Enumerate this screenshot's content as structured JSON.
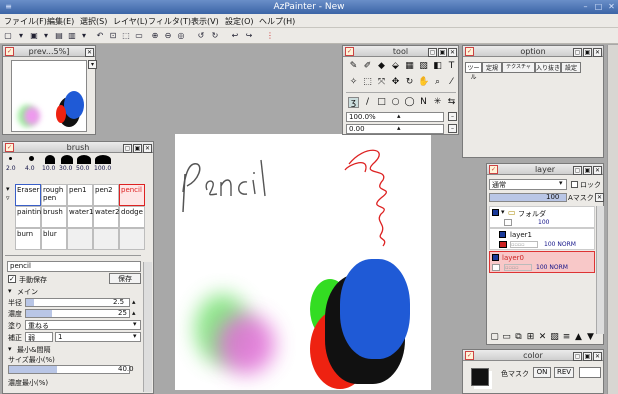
{
  "window": {
    "title": "AzPainter - New"
  },
  "menu": [
    "ファイル(F)",
    "編集(E)",
    "選択(S)",
    "レイヤ(L)",
    "フィルタ(T)",
    "表示(V)",
    "設定(O)",
    "ヘルプ(H)"
  ],
  "preview": {
    "title": "prev...5%]"
  },
  "tool": {
    "title": "tool",
    "zoom": "100.0%",
    "angle": "0.00"
  },
  "option": {
    "title": "option",
    "tabs": [
      "ツール",
      "定規",
      "テクスチャ",
      "入り抜き",
      "設定"
    ]
  },
  "brush": {
    "title": "brush",
    "sizes": [
      "2.0",
      "4.0",
      "10.0",
      "30.0",
      "50.0",
      "100.0"
    ],
    "presets": [
      [
        "Eraser",
        "rough pen",
        "pen1",
        "pen2",
        "pencil"
      ],
      [
        "painting",
        "brush",
        "water1",
        "water2",
        "dodge"
      ],
      [
        "burn",
        "blur",
        "",
        "",
        ""
      ]
    ],
    "name": "pencil",
    "autosave": "手動保存",
    "save": "保存",
    "section_main": "メイン",
    "radius_label": "半径",
    "radius": "2.5",
    "density_label": "濃度",
    "density": "25",
    "paint_label": "塗り",
    "paint": "重ねる",
    "correct_label": "補正",
    "correct_mode": "弱",
    "correct_val": "1",
    "section_min": "最小&間隔",
    "size_min_label": "サイズ最小(%)",
    "size_min": "40.0",
    "density_min_label": "濃度最小(%)"
  },
  "layer": {
    "title": "layer",
    "blend": "通常",
    "lock": "ロック",
    "opacity": "100",
    "amask": "Aマスク",
    "items": [
      {
        "name": "フォルダ",
        "info": "100"
      },
      {
        "name": "layer1",
        "info": "100 NORM"
      },
      {
        "name": "layer0",
        "info": "100 NORM"
      }
    ]
  },
  "color": {
    "title": "color",
    "mask": "色マスク",
    "on": "ON",
    "rev": "REV"
  },
  "colors": {
    "selected_layer": "#f8c8c8",
    "accent": "#3b64a6"
  }
}
